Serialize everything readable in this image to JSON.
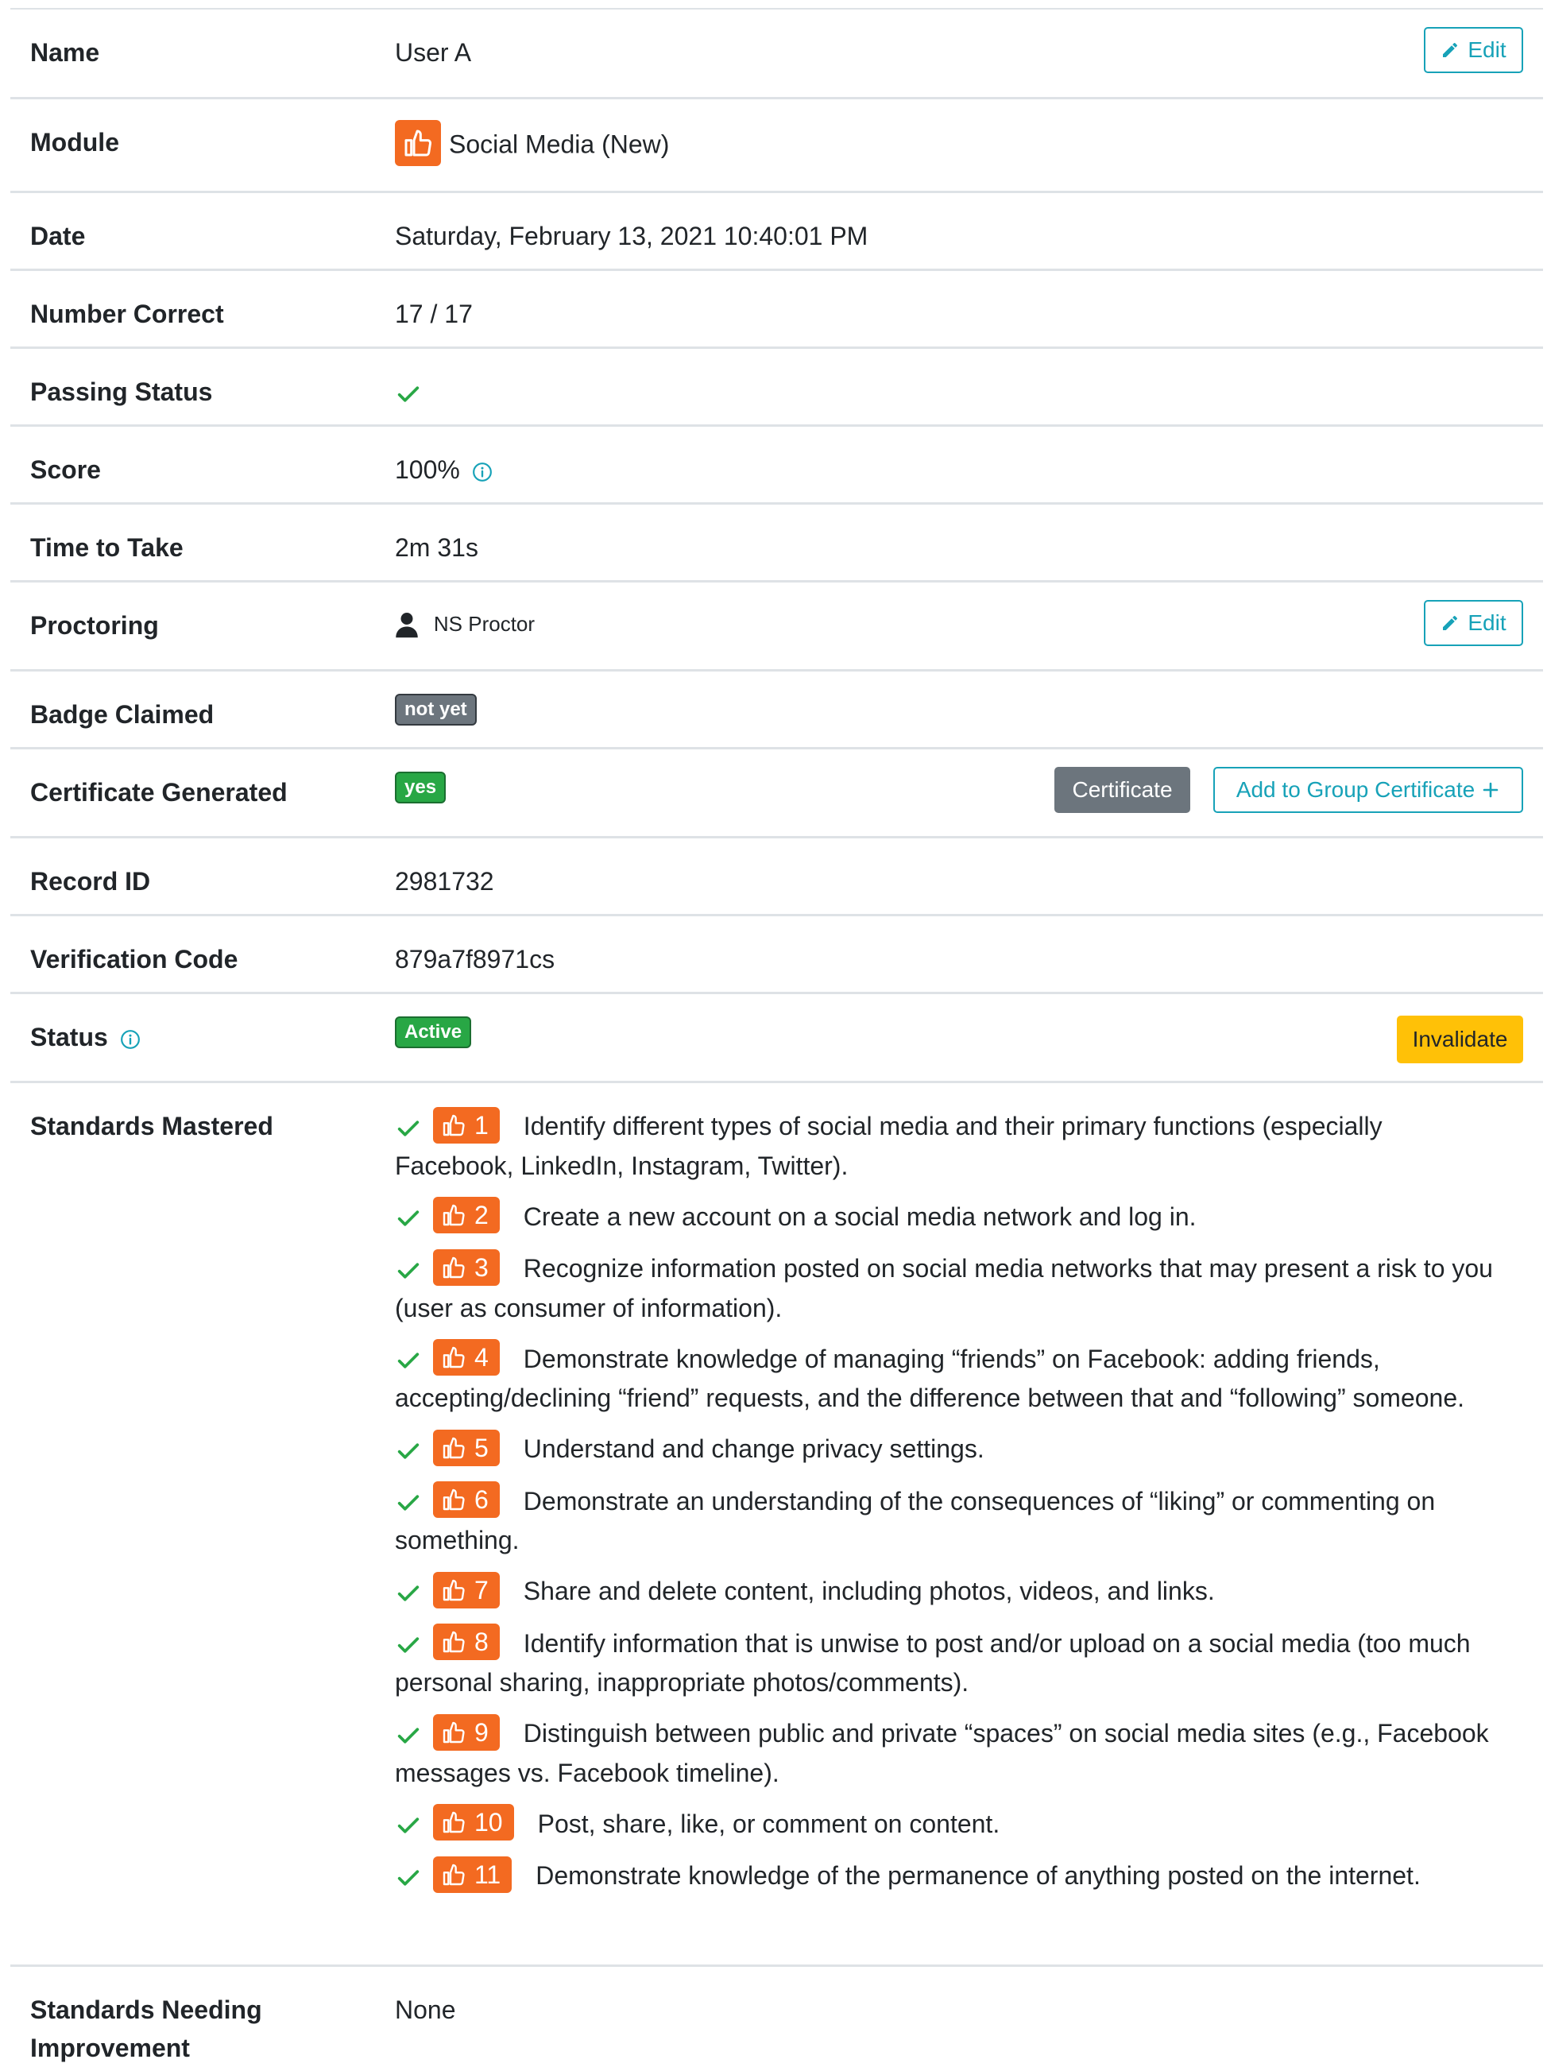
{
  "rows": {
    "name": {
      "label": "Name",
      "value": "User A",
      "edit_label": "Edit"
    },
    "module": {
      "label": "Module",
      "value": "Social Media (New)",
      "icon": "thumbs-up-icon",
      "icon_color": "#f36a21"
    },
    "date": {
      "label": "Date",
      "value": "Saturday, February 13, 2021 10:40:01 PM"
    },
    "number_correct": {
      "label": "Number Correct",
      "value": "17 / 17"
    },
    "passing_status": {
      "label": "Passing Status",
      "icon": "check-icon"
    },
    "score": {
      "label": "Score",
      "value": "100%"
    },
    "time_to_take": {
      "label": "Time to Take",
      "value": "2m 31s"
    },
    "proctoring": {
      "label": "Proctoring",
      "value": "NS Proctor",
      "edit_label": "Edit"
    },
    "badge_claimed": {
      "label": "Badge Claimed",
      "value": "not yet"
    },
    "certificate_generated": {
      "label": "Certificate Generated",
      "value": "yes",
      "certificate_label": "Certificate",
      "group_label": "Add to Group Certificate"
    },
    "record_id": {
      "label": "Record ID",
      "value": "2981732"
    },
    "verification_code": {
      "label": "Verification Code",
      "value": "879a7f8971cs"
    },
    "status": {
      "label": "Status",
      "value": "Active",
      "invalidate_label": "Invalidate"
    },
    "standards_mastered": {
      "label": "Standards Mastered",
      "items": [
        {
          "num": "1",
          "text": "Identify different types of social media and their primary functions (especially Facebook, LinkedIn, Instagram, Twitter)."
        },
        {
          "num": "2",
          "text": "Create a new account on a social media network and log in."
        },
        {
          "num": "3",
          "text": "Recognize information posted on social media networks that may present a risk to you (user as consumer of information)."
        },
        {
          "num": "4",
          "text": "Demonstrate knowledge of managing “friends” on Facebook: adding friends, accepting/declining “friend” requests, and the difference between that and “following” someone."
        },
        {
          "num": "5",
          "text": "Understand and change privacy settings."
        },
        {
          "num": "6",
          "text": "Demonstrate an understanding of the consequences of “liking” or commenting on something."
        },
        {
          "num": "7",
          "text": "Share and delete content, including photos, videos, and links."
        },
        {
          "num": "8",
          "text": "Identify information that is unwise to post and/or upload on a social media (too much personal sharing, inappropriate photos/comments)."
        },
        {
          "num": "9",
          "text": "Distinguish between public and private “spaces” on social media sites (e.g., Facebook messages vs. Facebook timeline)."
        },
        {
          "num": "10",
          "text": "Post, share, like, or comment on content."
        },
        {
          "num": "11",
          "text": "Demonstrate knowledge of the permanence of anything posted on the internet."
        }
      ]
    },
    "standards_needing": {
      "label_line1": "Standards Needing",
      "label_line2": "Improvement",
      "value": "None"
    }
  },
  "colors": {
    "accent": "#17a2b8",
    "success": "#28a745",
    "warning": "#ffc107",
    "brand": "#f36a21",
    "secondary": "#6c757d"
  }
}
